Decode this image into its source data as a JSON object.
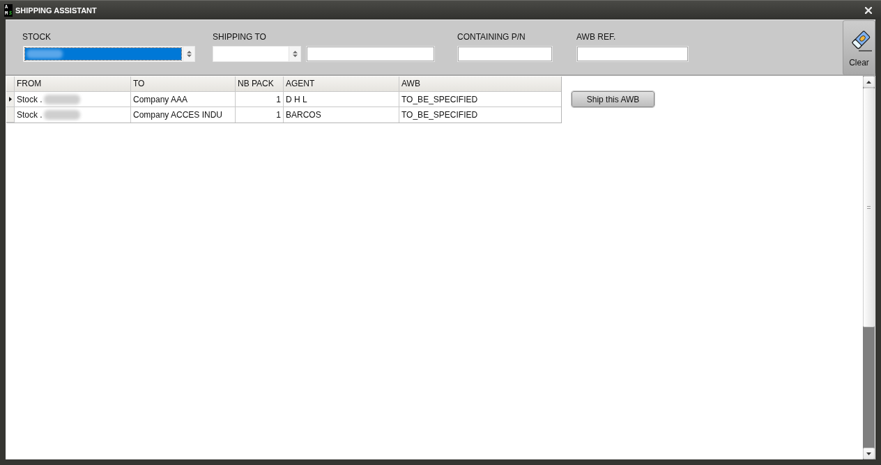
{
  "window": {
    "title": "SHIPPING ASSISTANT",
    "logo": {
      "letters": [
        "A",
        "M",
        "S"
      ]
    }
  },
  "filters": [
    {
      "kind": "combo",
      "label": "STOCK",
      "focused": true,
      "blurred": true
    },
    {
      "kind": "combo_text",
      "label": "SHIPPING TO",
      "focused": false,
      "blurred": false
    },
    {
      "kind": "text",
      "label": "CONTAINING P/N"
    },
    {
      "kind": "text",
      "label": "AWB REF."
    }
  ],
  "clear_button": {
    "label": "Clear"
  },
  "grid": {
    "columns": [
      {
        "label": "FROM",
        "kind": "text"
      },
      {
        "label": "TO",
        "kind": "text"
      },
      {
        "label": "NB PACK",
        "kind": "number"
      },
      {
        "label": "AGENT",
        "kind": "text"
      },
      {
        "label": "AWB",
        "kind": "text"
      }
    ],
    "rows": [
      {
        "current": true,
        "cells": [
          {
            "text": "Stock .",
            "blurred": true
          },
          {
            "text": "Company AAA",
            "blurred": false
          },
          {
            "text": "1",
            "blurred": false
          },
          {
            "text": "D H L",
            "blurred": false
          },
          {
            "text": "TO_BE_SPECIFIED",
            "blurred": false
          }
        ]
      },
      {
        "current": false,
        "cells": [
          {
            "text": "Stock .",
            "blurred": true
          },
          {
            "text": "Company ACCES INDU",
            "blurred": false
          },
          {
            "text": "1",
            "blurred": false
          },
          {
            "text": "BARCOS",
            "blurred": false
          },
          {
            "text": "TO_BE_SPECIFIED",
            "blurred": false
          }
        ]
      }
    ]
  },
  "ship_button": {
    "label": "Ship this AWB"
  }
}
